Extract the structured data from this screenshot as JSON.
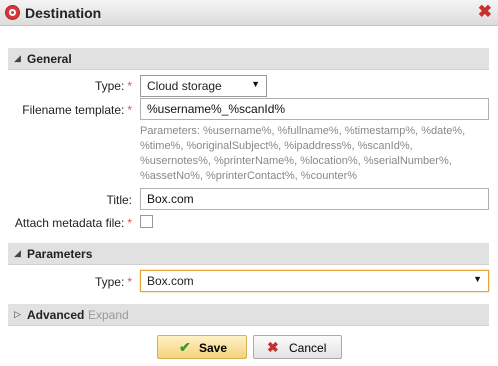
{
  "dialog": {
    "title": "Destination"
  },
  "general": {
    "header": "General",
    "type_label": "Type:",
    "type_value": "Cloud storage",
    "filename_label": "Filename template:",
    "filename_value": "%username%_%scanId%",
    "parameters_help": "Parameters: %username%, %fullname%, %timestamp%, %date%, %time%, %originalSubject%, %ipaddress%, %scanId%, %usernotes%, %printerName%, %location%, %serialNumber%, %assetNo%, %printerContact%, %counter%",
    "title_label": "Title:",
    "title_value": "Box.com",
    "attach_label": "Attach metadata file:"
  },
  "parameters": {
    "header": "Parameters",
    "type_label": "Type:",
    "type_value": "Box.com"
  },
  "advanced": {
    "header": "Advanced",
    "expand": "Expand"
  },
  "buttons": {
    "save": "Save",
    "cancel": "Cancel"
  },
  "required_marker": "*",
  "colors": {
    "required": "#d9534f",
    "save_bg": "#f4d27c",
    "accent_border": "#e6a23c"
  }
}
